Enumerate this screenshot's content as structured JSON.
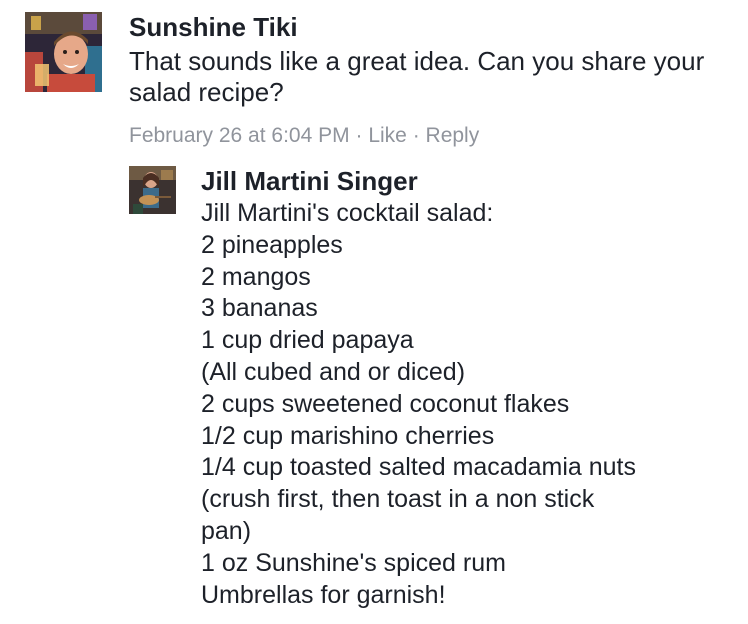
{
  "parent_comment": {
    "author": "Sunshine Tiki",
    "text": "That sounds like a great idea.  Can you share your salad recipe?",
    "timestamp": "February 26 at 6:04 PM",
    "separator": "·",
    "like_label": "Like",
    "reply_label": "Reply",
    "avatar_icon": "profile-photo"
  },
  "reply_comment": {
    "author": "Jill Martini Singer",
    "avatar_icon": "profile-photo",
    "lines": [
      "Jill Martini's cocktail salad:",
      "2 pineapples",
      "2 mangos",
      "3 bananas",
      "1 cup dried papaya",
      "(All cubed and or diced)",
      "2 cups sweetened coconut flakes",
      "1/2 cup marishino cherries",
      "1/4 cup toasted salted macadamia nuts",
      "(crush first, then toast in a non stick",
      "pan)",
      "1 oz Sunshine's spiced rum",
      "Umbrellas for garnish!"
    ]
  },
  "colors": {
    "text": "#1d2129",
    "meta": "#90949c",
    "background": "#ffffff"
  }
}
